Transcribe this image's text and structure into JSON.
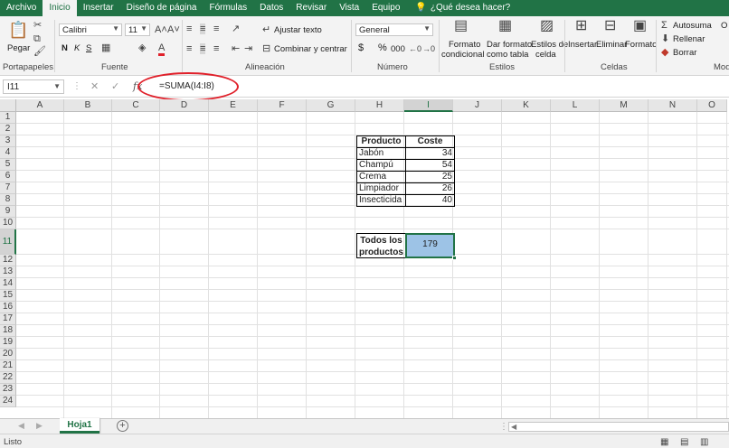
{
  "tabs": [
    "Archivo",
    "Inicio",
    "Insertar",
    "Diseño de página",
    "Fórmulas",
    "Datos",
    "Revisar",
    "Vista",
    "Equipo"
  ],
  "tell_me": "¿Qué desea hacer?",
  "ribbon": {
    "paste": "Pegar",
    "font_name": "Calibri",
    "font_size": "11",
    "bold": "N",
    "italic": "K",
    "underline": "S",
    "wrap_text": "Ajustar texto",
    "merge_center": "Combinar y centrar",
    "number_format": "General",
    "currency": "$",
    "percent": "%",
    "thousands": "000",
    "cond_format_1": "Formato",
    "cond_format_2": "condicional",
    "table_format_1": "Dar formato",
    "table_format_2": "como tabla",
    "cell_styles_1": "Estilos de",
    "cell_styles_2": "celda",
    "insert": "Insertar",
    "delete": "Eliminar",
    "format": "Formato",
    "autosum": "Autosuma",
    "fill": "Rellenar",
    "clear": "Borrar",
    "extra": "O",
    "groups": {
      "clipboard": "Portapapeles",
      "font": "Fuente",
      "alignment": "Alineación",
      "number": "Número",
      "styles": "Estilos",
      "cells": "Celdas",
      "modify": "Mod"
    }
  },
  "formula_bar": {
    "name_box": "I11",
    "formula": "=SUMA(I4:I8)"
  },
  "columns": [
    "A",
    "B",
    "C",
    "D",
    "E",
    "F",
    "G",
    "H",
    "I",
    "J",
    "K",
    "L",
    "M",
    "N",
    "O"
  ],
  "rows": [
    "1",
    "2",
    "3",
    "4",
    "5",
    "6",
    "7",
    "8",
    "9",
    "10",
    "11",
    "12",
    "13",
    "14",
    "15",
    "16",
    "17",
    "18",
    "19",
    "20",
    "21",
    "22",
    "23",
    "24"
  ],
  "table": {
    "header_product": "Producto",
    "header_cost": "Coste",
    "items": [
      {
        "product": "Jabón",
        "cost": "34"
      },
      {
        "product": "Champú",
        "cost": "54"
      },
      {
        "product": "Crema",
        "cost": "25"
      },
      {
        "product": "Limpiador",
        "cost": "26"
      },
      {
        "product": "Insecticida",
        "cost": "40"
      }
    ],
    "total_label_1": "Todos los",
    "total_label_2": "productos",
    "total_value": "179"
  },
  "sheet_tab": "Hoja1",
  "status": "Listo",
  "colors": {
    "accent": "#217346",
    "selection": "#9dc3e6",
    "annotation": "#e0202a"
  }
}
